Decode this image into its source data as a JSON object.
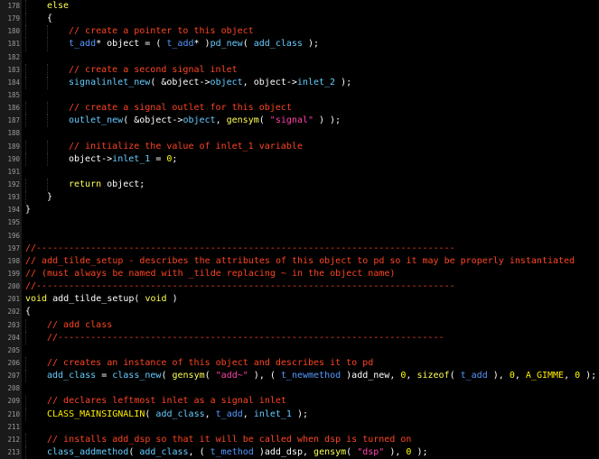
{
  "editor": {
    "colors": {
      "background": "#000000",
      "gutter_background": "#1a1a1a",
      "line_number": "#9a9a9a",
      "comment": "#ff4422",
      "keyword": "#ffff55",
      "type": "#5599ff",
      "function": "#66ccff",
      "string": "#ff44aa",
      "number": "#ffff00",
      "macro": "#ffee00",
      "plain": "#ffffff"
    },
    "lines": [
      {
        "num": "178",
        "indent": 1,
        "tokens": [
          {
            "t": "else",
            "c": "keyword"
          }
        ]
      },
      {
        "num": "179",
        "indent": 1,
        "tokens": [
          {
            "t": "{",
            "c": "plain"
          }
        ]
      },
      {
        "num": "180",
        "indent": 2,
        "tokens": [
          {
            "t": "// create a pointer to this object",
            "c": "comment"
          }
        ]
      },
      {
        "num": "181",
        "indent": 2,
        "tokens": [
          {
            "t": "t_add",
            "c": "type"
          },
          {
            "t": "* object = ( ",
            "c": "plain"
          },
          {
            "t": "t_add",
            "c": "type"
          },
          {
            "t": "* )",
            "c": "plain"
          },
          {
            "t": "pd_new",
            "c": "func"
          },
          {
            "t": "( ",
            "c": "plain"
          },
          {
            "t": "add_class",
            "c": "func"
          },
          {
            "t": " );",
            "c": "plain"
          }
        ]
      },
      {
        "num": "182",
        "indent": 0,
        "tokens": []
      },
      {
        "num": "183",
        "indent": 2,
        "tokens": [
          {
            "t": "// create a second signal inlet",
            "c": "comment"
          }
        ]
      },
      {
        "num": "184",
        "indent": 2,
        "tokens": [
          {
            "t": "signalinlet_new",
            "c": "func"
          },
          {
            "t": "( &object->",
            "c": "plain"
          },
          {
            "t": "object",
            "c": "func"
          },
          {
            "t": ", object->",
            "c": "plain"
          },
          {
            "t": "inlet_2",
            "c": "func"
          },
          {
            "t": " );",
            "c": "plain"
          }
        ]
      },
      {
        "num": "185",
        "indent": 0,
        "tokens": []
      },
      {
        "num": "186",
        "indent": 2,
        "tokens": [
          {
            "t": "// create a signal outlet for this object",
            "c": "comment"
          }
        ]
      },
      {
        "num": "187",
        "indent": 2,
        "tokens": [
          {
            "t": "outlet_new",
            "c": "func"
          },
          {
            "t": "( &object->",
            "c": "plain"
          },
          {
            "t": "object",
            "c": "func"
          },
          {
            "t": ", ",
            "c": "plain"
          },
          {
            "t": "gensym",
            "c": "keyword"
          },
          {
            "t": "( ",
            "c": "plain"
          },
          {
            "t": "\"signal\"",
            "c": "string"
          },
          {
            "t": " ) );",
            "c": "plain"
          }
        ]
      },
      {
        "num": "188",
        "indent": 0,
        "tokens": []
      },
      {
        "num": "189",
        "indent": 2,
        "tokens": [
          {
            "t": "// initialize the value of inlet_1 variable",
            "c": "comment"
          }
        ]
      },
      {
        "num": "190",
        "indent": 2,
        "tokens": [
          {
            "t": "object->",
            "c": "plain"
          },
          {
            "t": "inlet_1",
            "c": "func"
          },
          {
            "t": " = ",
            "c": "plain"
          },
          {
            "t": "0",
            "c": "number"
          },
          {
            "t": ";",
            "c": "plain"
          }
        ]
      },
      {
        "num": "191",
        "indent": 0,
        "tokens": []
      },
      {
        "num": "192",
        "indent": 2,
        "tokens": [
          {
            "t": "return",
            "c": "keyword"
          },
          {
            "t": " object;",
            "c": "plain"
          }
        ]
      },
      {
        "num": "193",
        "indent": 1,
        "tokens": [
          {
            "t": "}",
            "c": "plain"
          }
        ]
      },
      {
        "num": "194",
        "indent": 0,
        "tokens": [
          {
            "t": "}",
            "c": "plain"
          }
        ]
      },
      {
        "num": "195",
        "indent": 0,
        "tokens": []
      },
      {
        "num": "196",
        "indent": 0,
        "tokens": []
      },
      {
        "num": "197",
        "indent": 0,
        "tokens": [
          {
            "t": "//-----------------------------------------------------------------------------",
            "c": "comment"
          }
        ]
      },
      {
        "num": "198",
        "indent": 0,
        "tokens": [
          {
            "t": "// add_tilde_setup - describes the attributes of this object to pd so it may be properly instantiated",
            "c": "comment"
          }
        ]
      },
      {
        "num": "199",
        "indent": 0,
        "tokens": [
          {
            "t": "// (must always be named with _tilde replacing ~ in the object name)",
            "c": "comment"
          }
        ]
      },
      {
        "num": "200",
        "indent": 0,
        "tokens": [
          {
            "t": "//-----------------------------------------------------------------------------",
            "c": "comment"
          }
        ]
      },
      {
        "num": "201",
        "indent": 0,
        "tokens": [
          {
            "t": "void",
            "c": "keyword"
          },
          {
            "t": " add_tilde_setup( ",
            "c": "plain"
          },
          {
            "t": "void",
            "c": "keyword"
          },
          {
            "t": " )",
            "c": "plain"
          }
        ]
      },
      {
        "num": "202",
        "indent": 0,
        "tokens": [
          {
            "t": "{",
            "c": "plain"
          }
        ]
      },
      {
        "num": "203",
        "indent": 1,
        "tokens": [
          {
            "t": "// add class",
            "c": "comment"
          }
        ]
      },
      {
        "num": "204",
        "indent": 1,
        "tokens": [
          {
            "t": "//-----------------------------------------------------------------------",
            "c": "comment"
          }
        ]
      },
      {
        "num": "205",
        "indent": 0,
        "tokens": []
      },
      {
        "num": "206",
        "indent": 1,
        "tokens": [
          {
            "t": "// creates an instance of this object and describes it to pd",
            "c": "comment"
          }
        ]
      },
      {
        "num": "207",
        "indent": 1,
        "tokens": [
          {
            "t": "add_class",
            "c": "func"
          },
          {
            "t": " = ",
            "c": "plain"
          },
          {
            "t": "class_new",
            "c": "func"
          },
          {
            "t": "( ",
            "c": "plain"
          },
          {
            "t": "gensym",
            "c": "keyword"
          },
          {
            "t": "( ",
            "c": "plain"
          },
          {
            "t": "\"add~\"",
            "c": "string"
          },
          {
            "t": " ), ( ",
            "c": "plain"
          },
          {
            "t": "t_newmethod",
            "c": "type"
          },
          {
            "t": " )add_new, ",
            "c": "plain"
          },
          {
            "t": "0",
            "c": "number"
          },
          {
            "t": ", ",
            "c": "plain"
          },
          {
            "t": "sizeof",
            "c": "keyword"
          },
          {
            "t": "( ",
            "c": "plain"
          },
          {
            "t": "t_add",
            "c": "type"
          },
          {
            "t": " ), ",
            "c": "plain"
          },
          {
            "t": "0",
            "c": "number"
          },
          {
            "t": ", ",
            "c": "plain"
          },
          {
            "t": "A_GIMME",
            "c": "macro"
          },
          {
            "t": ", ",
            "c": "plain"
          },
          {
            "t": "0",
            "c": "number"
          },
          {
            "t": " );",
            "c": "plain"
          }
        ]
      },
      {
        "num": "208",
        "indent": 0,
        "tokens": []
      },
      {
        "num": "209",
        "indent": 1,
        "tokens": [
          {
            "t": "// declares leftmost inlet as a signal inlet",
            "c": "comment"
          }
        ]
      },
      {
        "num": "210",
        "indent": 1,
        "tokens": [
          {
            "t": "CLASS_MAINSIGNALIN",
            "c": "macro"
          },
          {
            "t": "( ",
            "c": "plain"
          },
          {
            "t": "add_class",
            "c": "func"
          },
          {
            "t": ", ",
            "c": "plain"
          },
          {
            "t": "t_add",
            "c": "type"
          },
          {
            "t": ", ",
            "c": "plain"
          },
          {
            "t": "inlet_1",
            "c": "func"
          },
          {
            "t": " );",
            "c": "plain"
          }
        ]
      },
      {
        "num": "211",
        "indent": 0,
        "tokens": []
      },
      {
        "num": "212",
        "indent": 1,
        "tokens": [
          {
            "t": "// installs add_dsp so that it will be called when dsp is turned on",
            "c": "comment"
          }
        ]
      },
      {
        "num": "213",
        "indent": 1,
        "tokens": [
          {
            "t": "class_addmethod",
            "c": "func"
          },
          {
            "t": "( ",
            "c": "plain"
          },
          {
            "t": "add_class",
            "c": "func"
          },
          {
            "t": ", ( ",
            "c": "plain"
          },
          {
            "t": "t_method",
            "c": "type"
          },
          {
            "t": " )add_dsp, ",
            "c": "plain"
          },
          {
            "t": "gensym",
            "c": "keyword"
          },
          {
            "t": "( ",
            "c": "plain"
          },
          {
            "t": "\"dsp\"",
            "c": "string"
          },
          {
            "t": " ), ",
            "c": "plain"
          },
          {
            "t": "0",
            "c": "number"
          },
          {
            "t": " );",
            "c": "plain"
          }
        ]
      }
    ]
  }
}
